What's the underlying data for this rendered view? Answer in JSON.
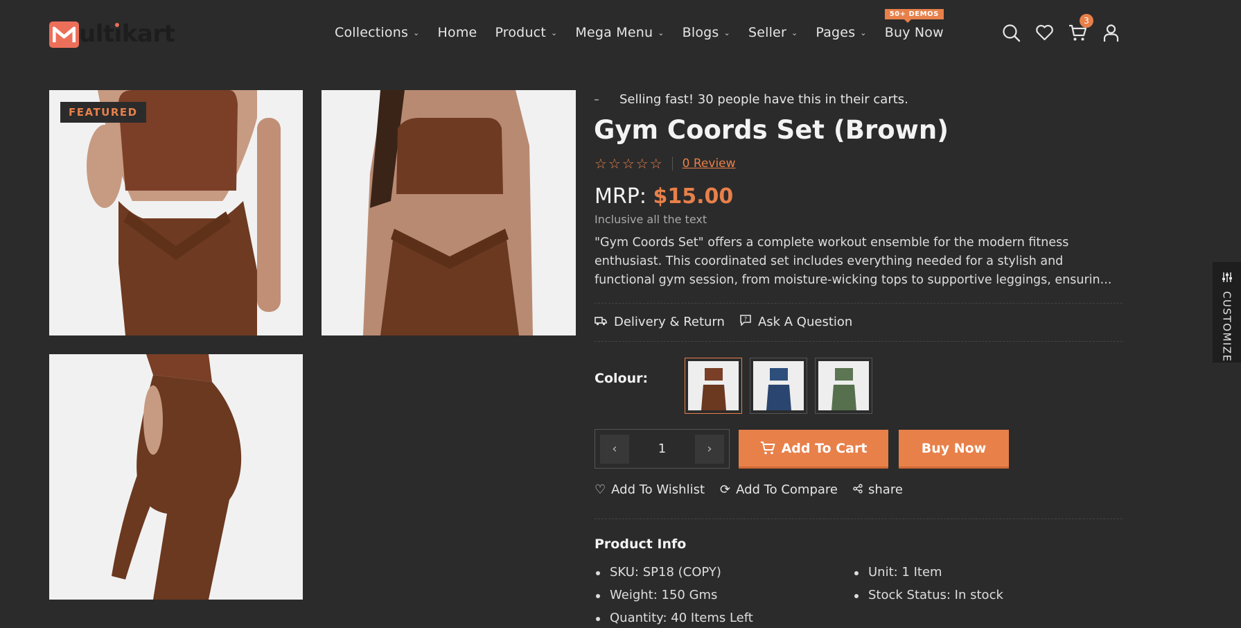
{
  "brand": {
    "logo_text": "ultikart"
  },
  "nav": {
    "items": [
      {
        "label": "Collections",
        "has_dropdown": true
      },
      {
        "label": "Home",
        "has_dropdown": false
      },
      {
        "label": "Product",
        "has_dropdown": true
      },
      {
        "label": "Mega Menu",
        "has_dropdown": true
      },
      {
        "label": "Blogs",
        "has_dropdown": true
      },
      {
        "label": "Seller",
        "has_dropdown": true
      },
      {
        "label": "Pages",
        "has_dropdown": true
      },
      {
        "label": "Buy Now",
        "has_dropdown": false
      }
    ],
    "badge": "50+ DEMOS"
  },
  "header_icons": {
    "cart_count": "3",
    "icons": [
      "search-icon",
      "heart-icon",
      "cart-icon",
      "user-icon"
    ]
  },
  "gallery": {
    "featured_label": "FEATURED"
  },
  "product": {
    "selling_note": "Selling fast! 30 people have this in their carts.",
    "title": "Gym Coords Set (Brown)",
    "review_link": "0 Review",
    "mrp_label": "MRP:",
    "price": "$15.00",
    "inclusive_note": "Inclusive all the text",
    "description": "\"Gym Coords Set\" offers a complete workout ensemble for the modern fitness enthusiast. This coordinated set includes everything needed for a stylish and functional gym session, from moisture-wicking tops to supportive leggings, ensurin...",
    "delivery_link": "Delivery & Return",
    "ask_link": "Ask A Question",
    "colour_label": "Colour:",
    "colours": [
      "brown",
      "blue",
      "green"
    ],
    "quantity": "1",
    "add_to_cart": "Add To Cart",
    "buy_now": "Buy Now",
    "wishlist": "Add To Wishlist",
    "compare": "Add To Compare",
    "share": "share"
  },
  "product_info": {
    "title": "Product Info",
    "left": [
      "SKU: SP18 (COPY)",
      "Weight: 150 Gms",
      "Quantity: 40 Items Left"
    ],
    "right": [
      "Unit: 1 Item",
      "Stock Status: In stock"
    ]
  },
  "customize": {
    "label": "CUSTOMIZE"
  },
  "colors": {
    "accent": "#e8804a",
    "background": "#2b2b2b",
    "logo": "#ec6f5a"
  }
}
